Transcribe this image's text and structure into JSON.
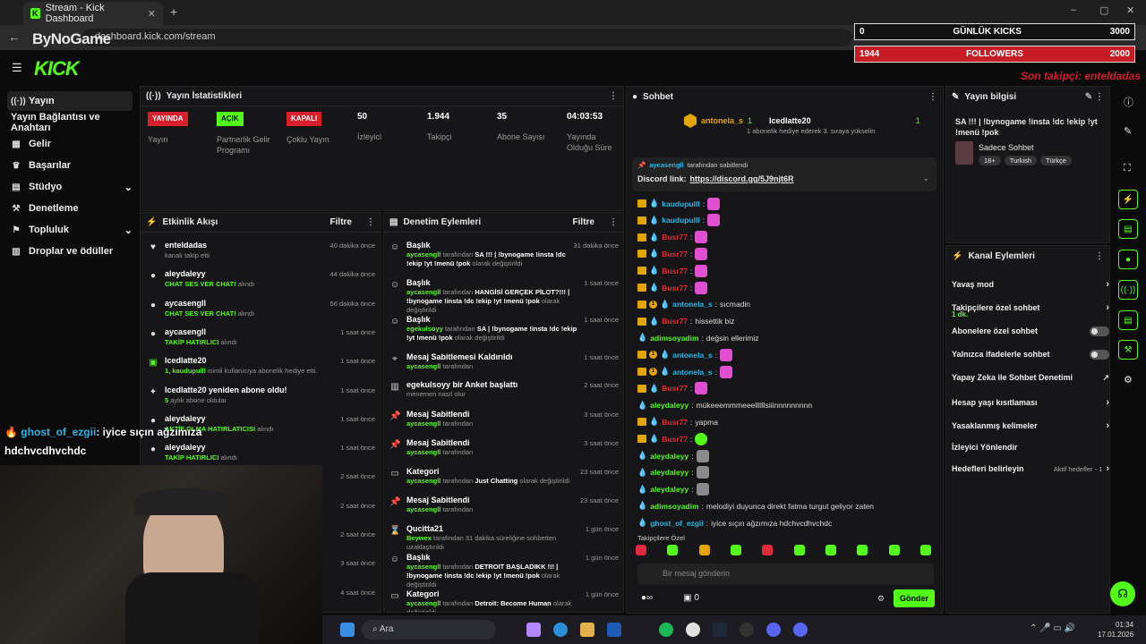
{
  "browser": {
    "tab_title": "Stream - Kick Dashboard",
    "url": "dashboard.kick.com/stream"
  },
  "overlay": {
    "brand": "ByNoGame",
    "daily_kicks": {
      "left": "0",
      "label": "GÜNLÜK KICKS",
      "right": "3000"
    },
    "followers": {
      "left": "1944",
      "label": "FOLLOWERS",
      "right": "2000"
    },
    "last_follower": "Son takipçi: enteldadas"
  },
  "logo": "KICK",
  "sidebar": {
    "items": [
      {
        "label": "Yayın",
        "icon": "stream-icon"
      },
      {
        "label": "Yayın Bağlantısı ve Anahtarı",
        "icon": ""
      },
      {
        "label": "Gelir",
        "icon": "revenue-icon"
      },
      {
        "label": "Başarılar",
        "icon": "trophy-icon"
      },
      {
        "label": "Stüdyo",
        "icon": "studio-icon"
      },
      {
        "label": "Denetleme",
        "icon": "moderation-icon"
      },
      {
        "label": "Topluluk",
        "icon": "community-icon"
      },
      {
        "label": "Droplar ve ödüller",
        "icon": "drops-icon"
      }
    ]
  },
  "stats": {
    "title": "Yayın İstatistikleri",
    "items": [
      {
        "badge": "YAYINDA",
        "label": "Yayın"
      },
      {
        "badge": "AÇIK",
        "label": "Partnerlik Gelir Programı"
      },
      {
        "badge": "KAPALI",
        "label": "Çoklu Yayın"
      },
      {
        "value": "50",
        "label": "İzleyici"
      },
      {
        "value": "1.944",
        "label": "Takipçi"
      },
      {
        "value": "35",
        "label": "Abone Sayısı"
      },
      {
        "value": "04:03:53",
        "label": "Yayında Olduğu Süre"
      }
    ]
  },
  "activity": {
    "title": "Etkinlik Akışı",
    "filter": "Filtre",
    "rows": [
      {
        "title": "enteldadas",
        "sub": "kanalı takip etti",
        "green": "",
        "time": "40 dakika önce"
      },
      {
        "title": "aleydaleyy",
        "green": "CHAT SES VER CHAT!",
        "sub": "alındı",
        "time": "44 dakika önce"
      },
      {
        "title": "aycasengll",
        "green": "CHAT SES VER CHAT!",
        "sub": "alındı",
        "time": "56 dakika önce"
      },
      {
        "title": "aycasengll",
        "green": "TAKİP HATIRLICI",
        "sub": "alındı",
        "time": "1 saat önce"
      },
      {
        "title": "Icedlatte20",
        "green": "1, kaudupulll",
        "sub": "isimli kullanıcıya abonelik hediye etti.",
        "time": "1 saat önce"
      },
      {
        "title": "Icedlatte20 yeniden abone oldu!",
        "green": "5",
        "sub": "aylık abone oldular",
        "time": "1 saat önce"
      },
      {
        "title": "aleydaleyy",
        "green": "AKTİF OLMA HATIRLATICISI",
        "sub": "alındı",
        "time": "1 saat önce"
      },
      {
        "title": "aleydaleyy",
        "green": "TAKİP HATIRLICI",
        "sub": "alındı",
        "time": "1 saat önce"
      },
      {
        "title": "",
        "green": "",
        "sub": "",
        "time": "2 saat önce"
      },
      {
        "title": "",
        "green": "",
        "sub": "",
        "time": "2 saat önce"
      },
      {
        "title": "",
        "green": "",
        "sub": "",
        "time": "2 saat önce"
      },
      {
        "title": "",
        "green": "",
        "sub": "",
        "time": "3 saat önce"
      },
      {
        "title": "",
        "green": "",
        "sub": "",
        "time": "4 saat önce"
      }
    ]
  },
  "moderation": {
    "title": "Denetim Eylemleri",
    "filter": "Filtre",
    "rows": [
      {
        "title": "Başlık",
        "user": "aycasengll",
        "mid": "tarafından",
        "text": "SA !!! | !bynogame !insta !dc !ekip !yt !menü !pok",
        "tail": "olarak değiştirildi",
        "time": "31 dakika önce"
      },
      {
        "title": "Başlık",
        "user": "aycasengll",
        "mid": "tarafından",
        "text": "HANGİSİ GERÇEK PİLOT?!!! | !bynogame !insta !dc !ekip !yt !menü !pok",
        "tail": "olarak değiştirildi",
        "time": "1 saat önce"
      },
      {
        "title": "Başlık",
        "user": "egekulsoyy",
        "mid": "tarafından",
        "text": "SA | !bynogame !insta !dc !ekip !yt !menü !pok",
        "tail": "olarak değiştirildi",
        "time": "1 saat önce"
      },
      {
        "title": "Mesaj Sabitlemesi Kaldırıldı",
        "user": "aycasengll",
        "mid": "tarafından",
        "text": "",
        "tail": "",
        "time": "1 saat önce"
      },
      {
        "title": "egekulsoyy bir Anket başlattı",
        "user": "",
        "mid": "menemen nasıl olur",
        "text": "",
        "tail": "",
        "time": "2 saat önce"
      },
      {
        "title": "Mesaj Sabitlendi",
        "user": "aycasengll",
        "mid": "tarafından",
        "text": "",
        "tail": "",
        "time": "3 saat önce"
      },
      {
        "title": "Mesaj Sabitlendi",
        "user": "aycasengll",
        "mid": "tarafından",
        "text": "",
        "tail": "",
        "time": "3 saat önce"
      },
      {
        "title": "Kategori",
        "user": "aycasengll",
        "mid": "tarafından",
        "text": "Just Chatting",
        "tail": "olarak değiştirildi",
        "time": "23 saat önce"
      },
      {
        "title": "Mesaj Sabitlendi",
        "user": "aycasengll",
        "mid": "tarafından",
        "text": "",
        "tail": "",
        "time": "23 saat önce"
      },
      {
        "title": "Qucitta21",
        "user": "Beywex",
        "mid": "tarafından 31 dakika süreliğine sohbetten uzaklaştırıldı",
        "text": "",
        "tail": "",
        "time": "1 gün önce"
      },
      {
        "title": "Başlık",
        "user": "aycasengll",
        "mid": "tarafından",
        "text": "DETROIT BAŞLADIKK !!! | !bynogame !insta !dc !ekip !yt !menü !pok",
        "tail": "olarak değiştirildi",
        "time": "1 gün önce"
      },
      {
        "title": "Kategori",
        "user": "aycasengll",
        "mid": "tarafından",
        "text": "Detroit: Become Human",
        "tail": "olarak değiştirildi",
        "time": "1 gün önce"
      }
    ]
  },
  "chat": {
    "title": "Sohbet",
    "gift_from": "antonela_s",
    "gift_from_count": "1",
    "gift_to": "Icedlatte20",
    "gift_to_count": "1",
    "gift_text": "1 abonelik hediye ederek 3. sıraya yükselin",
    "pinned_by": "aycasengll",
    "pinned_tail": "tarafından sabitlendi",
    "pinned_text": "Discord link:",
    "pinned_link": "https://discord.gg/5J9njt6R",
    "messages": [
      {
        "user": "kaudupulll",
        "color": "#2ab7e6",
        "text": "",
        "emote": "pink",
        "crown": true
      },
      {
        "user": "kaudupulll",
        "color": "#2ab7e6",
        "text": "",
        "emote": "pink",
        "crown": true
      },
      {
        "user": "Busr77",
        "color": "#e02a3c",
        "text": "",
        "emote": "pink",
        "crown": true
      },
      {
        "user": "Busr77",
        "color": "#e02a3c",
        "text": "",
        "emote": "pink",
        "crown": true
      },
      {
        "user": "Busr77",
        "color": "#e02a3c",
        "text": "",
        "emote": "pink",
        "crown": true
      },
      {
        "user": "Busr77",
        "color": "#e02a3c",
        "text": "",
        "emote": "pink",
        "crown": true
      },
      {
        "user": "antonela_s",
        "color": "#2ab7e6",
        "text": "sıcmadin",
        "emote": "",
        "crown": true
      },
      {
        "user": "Busr77",
        "color": "#e02a3c",
        "text": "hissettik biz",
        "emote": "",
        "crown": true
      },
      {
        "user": "adimsoyadim",
        "color": "#53fc18",
        "text": "değsin ellerimiz",
        "emote": "",
        "crown": false
      },
      {
        "user": "antonela_s",
        "color": "#2ab7e6",
        "text": "",
        "emote": "pink",
        "crown": true
      },
      {
        "user": "antonela_s",
        "color": "#2ab7e6",
        "text": "",
        "emote": "pink",
        "crown": true
      },
      {
        "user": "Busr77",
        "color": "#e02a3c",
        "text": "",
        "emote": "pink",
        "crown": true
      },
      {
        "user": "aleydaleyy",
        "color": "#53fc18",
        "text": "mükeeemmmeeellllllsiiinnnnnnnnn",
        "emote": "",
        "crown": false
      },
      {
        "user": "Busr77",
        "color": "#e02a3c",
        "text": "yapma",
        "emote": "",
        "crown": true
      },
      {
        "user": "Busr77",
        "color": "#e02a3c",
        "text": "",
        "emote": "green",
        "crown": true
      },
      {
        "user": "aleydaleyy",
        "color": "#53fc18",
        "text": "",
        "emote": "gray",
        "crown": false
      },
      {
        "user": "aleydaleyy",
        "color": "#53fc18",
        "text": "",
        "emote": "gray",
        "crown": false
      },
      {
        "user": "aleydaleyy",
        "color": "#53fc18",
        "text": "",
        "emote": "gray",
        "crown": false
      },
      {
        "user": "adimsoyadim",
        "color": "#53fc18",
        "text": "melodiyi duyunca direkt fatma turgut geliyor zaten",
        "emote": "",
        "crown": false
      },
      {
        "user": "ghost_of_ezgii",
        "color": "#2ab7e6",
        "text": "iyice sıçın ağzımıza hdchvcdhvchdc",
        "emote": "",
        "crown": false
      }
    ],
    "followers_only": "Takipçilere Özel",
    "placeholder": "Bir mesaj gönderin",
    "points": "0",
    "send": "Gönder"
  },
  "stream_info": {
    "title": "Yayın bilgisi",
    "stream_title": "SA !!! | !bynogame !insta !dc !ekip !yt !menü !pok",
    "category": "Sadece Sohbet",
    "tags": [
      "18+",
      "Turkish",
      "Türkçe"
    ]
  },
  "channel_actions": {
    "title": "Kanal Eylemleri",
    "rows": [
      {
        "label": "Yavaş mod",
        "sub": "",
        "control": "chevron"
      },
      {
        "label": "Takipçilere özel sohbet",
        "sub": "1 dk.",
        "control": "chevron"
      },
      {
        "label": "Abonelere özel sohbet",
        "sub": "",
        "control": "toggle"
      },
      {
        "label": "Yalnızca ifadelerle sohbet",
        "sub": "",
        "control": "toggle"
      },
      {
        "label": "Yapay Zeka ile Sohbet Denetimi",
        "sub": "",
        "control": "external"
      },
      {
        "label": "Hesap yaşı kısıtlaması",
        "sub": "",
        "control": "chevron"
      },
      {
        "label": "Yasaklanmış kelimeler",
        "sub": "",
        "control": "chevron"
      },
      {
        "label": "İzleyici Yönlendir",
        "sub": "",
        "control": ""
      },
      {
        "label": "Hedefleri belirleyin",
        "sub": "Aktif hedefler - 1",
        "control": "chevron"
      }
    ]
  },
  "stream_overlay_chat": {
    "user": "ghost_of_ezgii",
    "line1": ": iyice sıçın ağzımıza",
    "line2": "hdchvcdhvchdc"
  },
  "taskbar": {
    "search": "Ara",
    "time": "01:34",
    "date": "17.01.2026"
  }
}
